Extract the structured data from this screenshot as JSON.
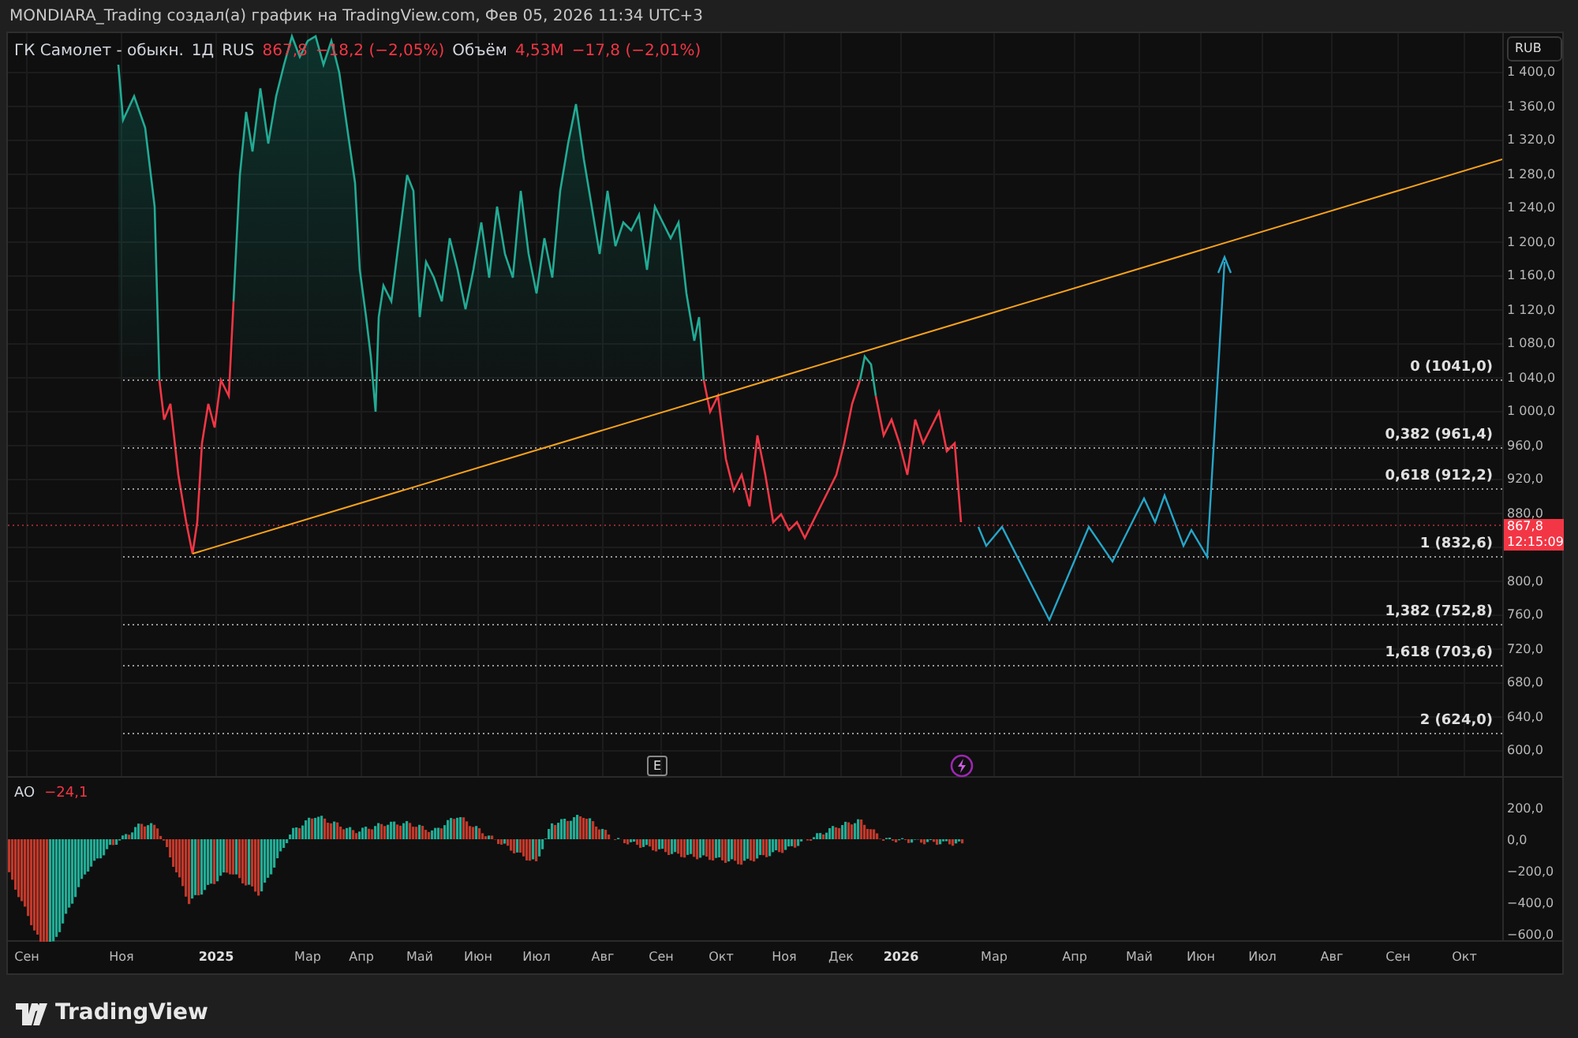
{
  "header": {
    "attribution": "MONDIARA_Trading создал(а) график на TradingView.com, Фев 05, 2026 11:34 UTC+3"
  },
  "legend": {
    "symbol": "ГК Самолет - обыкн.",
    "interval": "1Д",
    "exchange": "RUS",
    "price": "867,8",
    "change": "−18,2 (−2,05%)",
    "volume_label": "Объём",
    "volume": "4,53M",
    "volume_change": "−17,8 (−2,01%)"
  },
  "price_axis": {
    "currency": "RUB",
    "ticks": [
      "1 400,0",
      "1 360,0",
      "1 320,0",
      "1 280,0",
      "1 240,0",
      "1 200,0",
      "1 160,0",
      "1 120,0",
      "1 080,0",
      "1 040,0",
      "1 000,0",
      "960,0",
      "920,0",
      "880,0",
      "800,0",
      "760,0",
      "720,0",
      "680,0",
      "640,0",
      "600,0"
    ],
    "last_price": "867,8",
    "countdown": "12:15:09"
  },
  "fib_levels": [
    "0 (1041,0)",
    "0,382 (961,4)",
    "0,618 (912,2)",
    "1 (832,6)",
    "1,382 (752,8)",
    "1,618 (703,6)",
    "2 (624,0)"
  ],
  "event_marker": "E",
  "ao": {
    "name": "AO",
    "value": "−24,1",
    "ticks": [
      "200,0",
      "0,0",
      "−200,0",
      "−400,0",
      "−600,0"
    ]
  },
  "time_axis": [
    {
      "label": "Сен",
      "kind": "month"
    },
    {
      "label": "Ноя",
      "kind": "month"
    },
    {
      "label": "2025",
      "kind": "year"
    },
    {
      "label": "Мар",
      "kind": "month"
    },
    {
      "label": "Апр",
      "kind": "month"
    },
    {
      "label": "Май",
      "kind": "month"
    },
    {
      "label": "Июн",
      "kind": "month"
    },
    {
      "label": "Июл",
      "kind": "month"
    },
    {
      "label": "Авг",
      "kind": "month"
    },
    {
      "label": "Сен",
      "kind": "month"
    },
    {
      "label": "Окт",
      "kind": "month"
    },
    {
      "label": "Ноя",
      "kind": "month"
    },
    {
      "label": "Дек",
      "kind": "month"
    },
    {
      "label": "2026",
      "kind": "year"
    },
    {
      "label": "Мар",
      "kind": "month"
    },
    {
      "label": "Апр",
      "kind": "month"
    },
    {
      "label": "Май",
      "kind": "month"
    },
    {
      "label": "Июн",
      "kind": "month"
    },
    {
      "label": "Июл",
      "kind": "month"
    },
    {
      "label": "Авг",
      "kind": "month"
    },
    {
      "label": "Сен",
      "kind": "month"
    },
    {
      "label": "Окт",
      "kind": "month"
    }
  ],
  "footer": {
    "brand": "TradingView"
  }
}
